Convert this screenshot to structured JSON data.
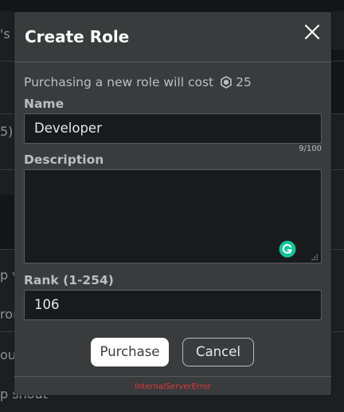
{
  "background": {
    "snippets": [
      "'s",
      "5)",
      "p v",
      "rou",
      "oup",
      "p shout"
    ]
  },
  "modal": {
    "title": "Create Role",
    "close_label": "close",
    "cost": {
      "prefix": "Purchasing a new role will cost",
      "amount": "25",
      "icon": "robux-icon"
    },
    "name": {
      "label": "Name",
      "value": "Developer",
      "char_count": "9/100"
    },
    "description": {
      "label": "Description",
      "value": ""
    },
    "rank": {
      "label": "Rank (1-254)",
      "value": "106"
    },
    "buttons": {
      "purchase": "Purchase",
      "cancel": "Cancel"
    },
    "error": "InternalServerError"
  },
  "colors": {
    "modal_bg": "#393b3d",
    "input_bg": "#191a1c",
    "error": "#e33a36",
    "grammarly": "#15c39a"
  }
}
